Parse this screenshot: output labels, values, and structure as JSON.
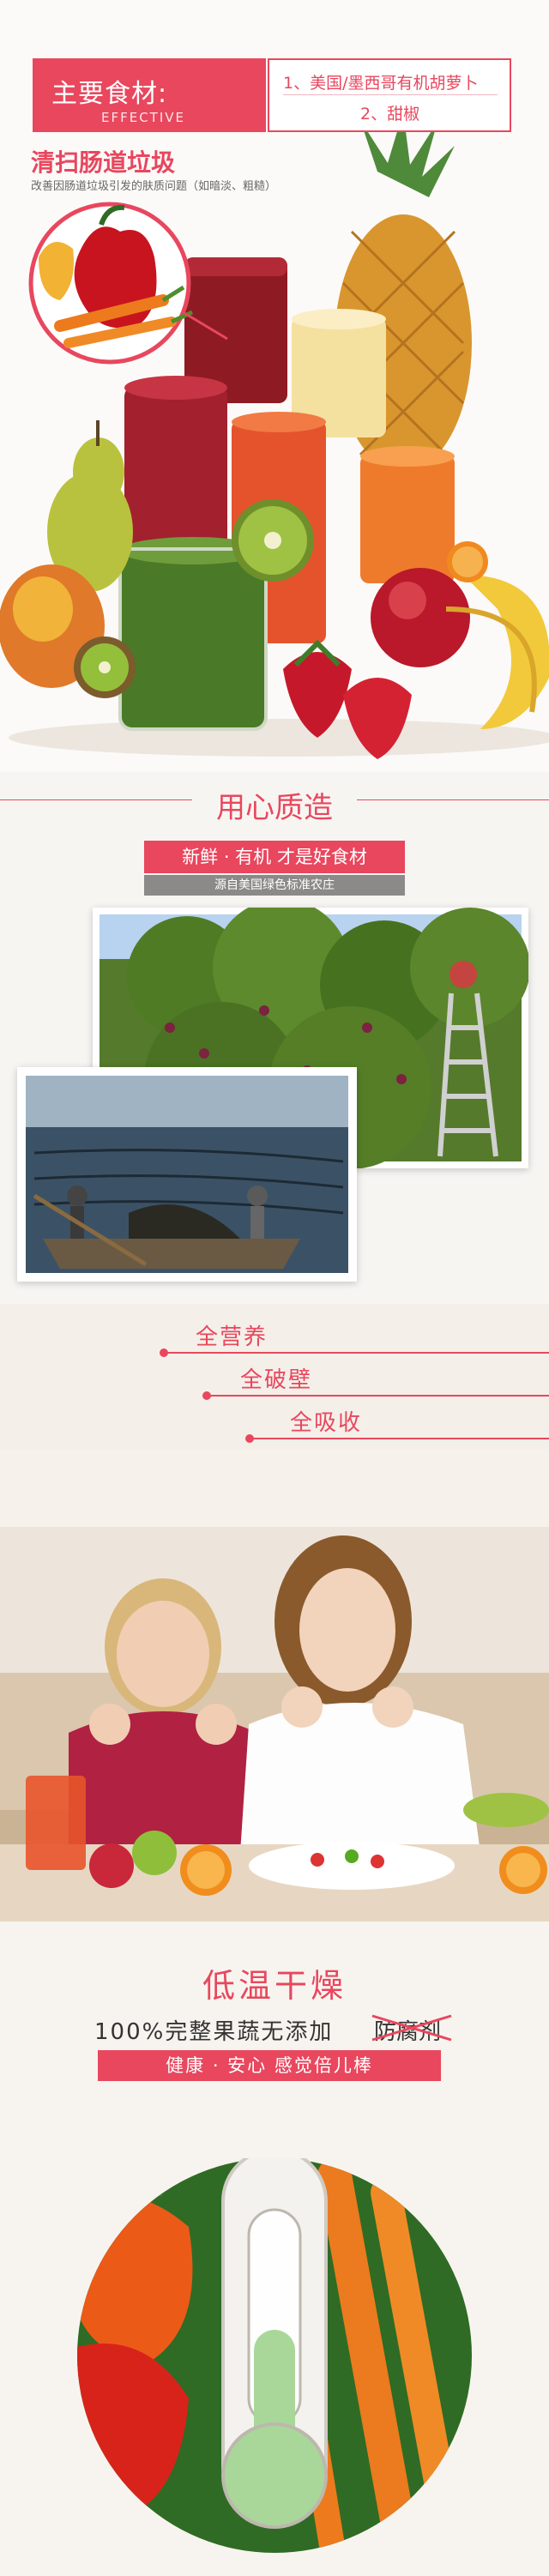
{
  "header": {
    "title": "主要食材:",
    "subtitle": "EFFECTIVE",
    "ingredients": [
      "1、美国/墨西哥有机胡萝卜",
      "2、甜椒"
    ]
  },
  "clean": {
    "title": "清扫肠道垃圾",
    "subtitle": "改善因肠道垃圾引发的肤质问题（如暗淡、粗糙）"
  },
  "craft": {
    "title": "用心质造",
    "fresh": "新鲜 · 有机  才是好食材",
    "source": "源自美国绿色标准农庄"
  },
  "nutrition": {
    "items": [
      "全营养",
      "全破壁",
      "全吸收"
    ]
  },
  "lowtemp": {
    "title": "低温干燥",
    "tagline": "100%完整果蔬无添加",
    "struck": "防腐剂",
    "health": "健康 · 安心  感觉倍儿棒"
  },
  "colors": {
    "accent": "#e8475e",
    "gray_banner": "#8b8a89"
  }
}
